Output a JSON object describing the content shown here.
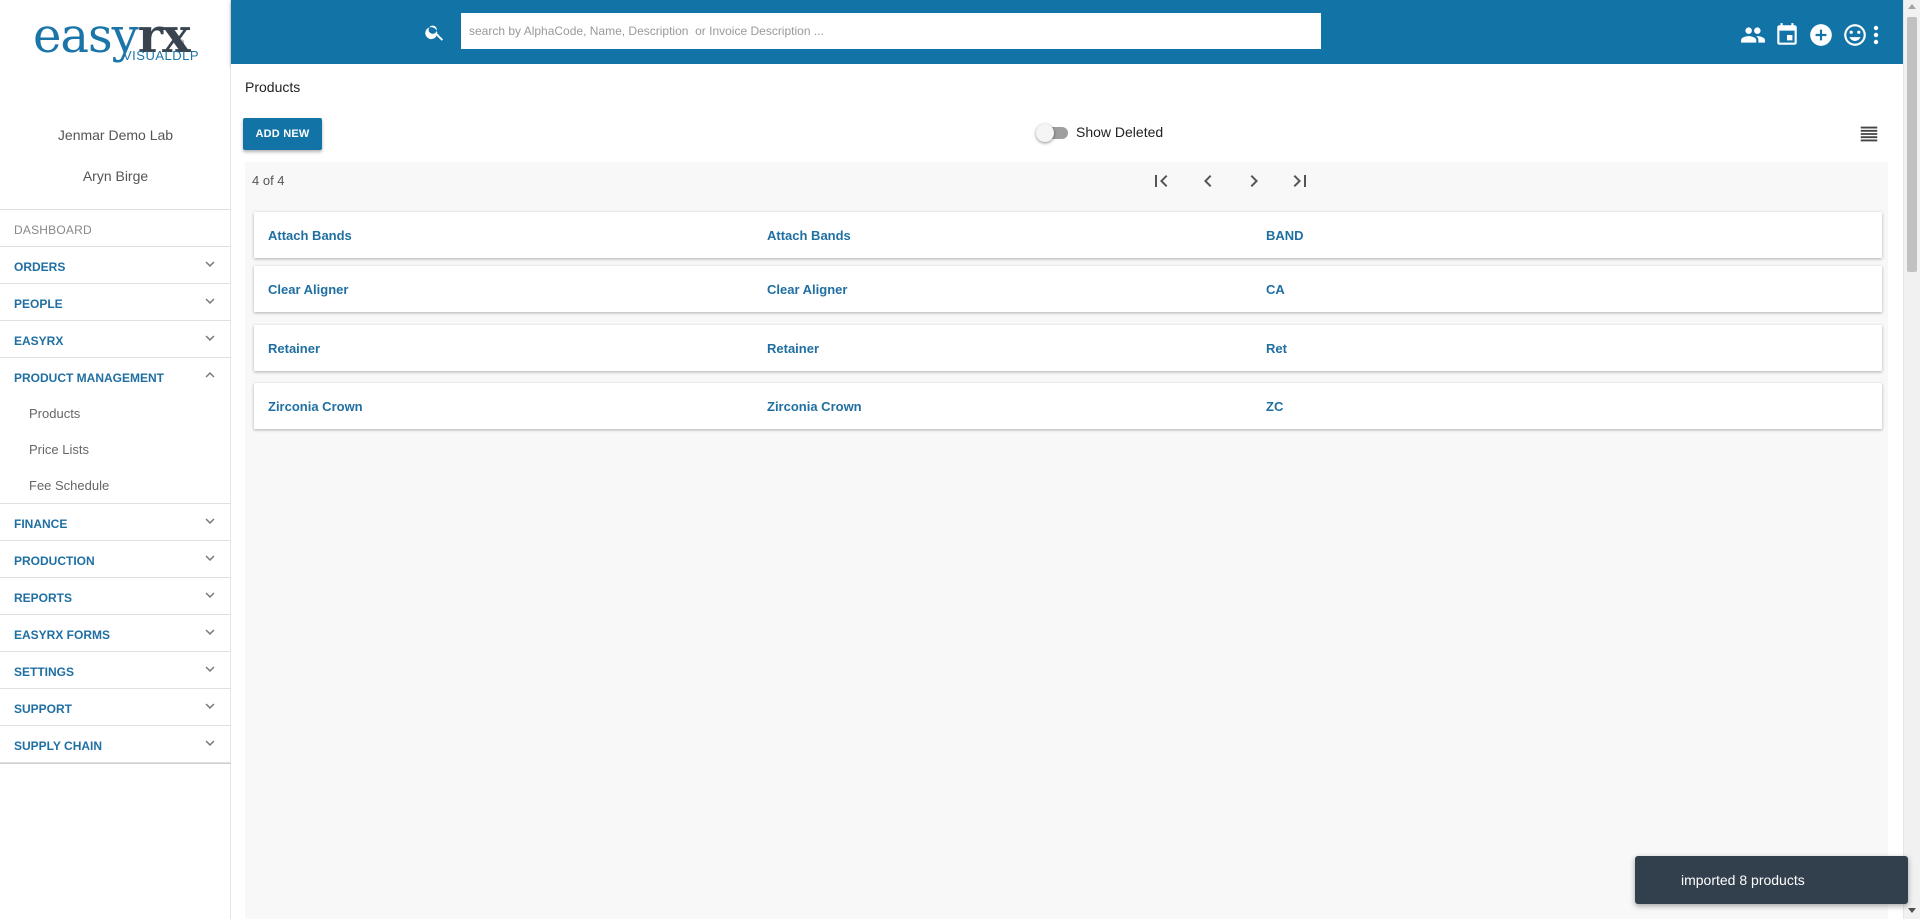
{
  "logo": {
    "brand_main": "easy",
    "brand_accent": "rx",
    "sub": "VISUALDLP",
    "reg": "®"
  },
  "sidebar": {
    "lab_name": "Jenmar Demo Lab",
    "user_name": "Aryn Birge",
    "dashboard": "DASHBOARD",
    "items": [
      {
        "label": "ORDERS",
        "icon": "chevron-down-icon"
      },
      {
        "label": "PEOPLE",
        "icon": "chevron-down-icon"
      },
      {
        "label": "EASYRX",
        "icon": "chevron-down-icon"
      }
    ],
    "product_management": {
      "label": "PRODUCT MANAGEMENT",
      "icon": "chevron-up-icon",
      "sub_items": [
        "Products",
        "Price Lists",
        "Fee Schedule"
      ]
    },
    "items_after": [
      {
        "label": "FINANCE",
        "icon": "chevron-down-icon"
      },
      {
        "label": "PRODUCTION",
        "icon": "chevron-down-icon"
      },
      {
        "label": "REPORTS",
        "icon": "chevron-down-icon"
      },
      {
        "label": "EASYRX FORMS",
        "icon": "chevron-down-icon"
      },
      {
        "label": "SETTINGS",
        "icon": "chevron-down-icon"
      },
      {
        "label": "SUPPORT",
        "icon": "chevron-down-icon"
      },
      {
        "label": "SUPPLY CHAIN",
        "icon": "chevron-down-icon"
      }
    ]
  },
  "topbar": {
    "search_placeholder": "search by AlphaCode, Name, Description  or Invoice Description ...",
    "search_value": "",
    "icons": [
      "people-icon",
      "calendar-icon",
      "add-circle-icon",
      "smiley-icon",
      "more-vert-icon"
    ]
  },
  "main": {
    "title": "Products",
    "add_button": "ADD NEW",
    "show_deleted_label": "Show Deleted",
    "show_deleted_on": false,
    "count_text": "4 of 4",
    "rows": [
      {
        "name": "Attach Bands",
        "description": "Attach Bands",
        "code": "BAND"
      },
      {
        "name": "Clear Aligner",
        "description": "Clear Aligner",
        "code": "CA"
      },
      {
        "name": "Retainer",
        "description": "Retainer",
        "code": "Ret"
      },
      {
        "name": "Zirconia Crown",
        "description": "Zirconia Crown",
        "code": "ZC"
      }
    ]
  },
  "toast": {
    "message": "imported 8 products"
  },
  "colors": {
    "primary": "#1273a6",
    "link": "#1f6fa3",
    "toast_bg": "#323f4d"
  }
}
